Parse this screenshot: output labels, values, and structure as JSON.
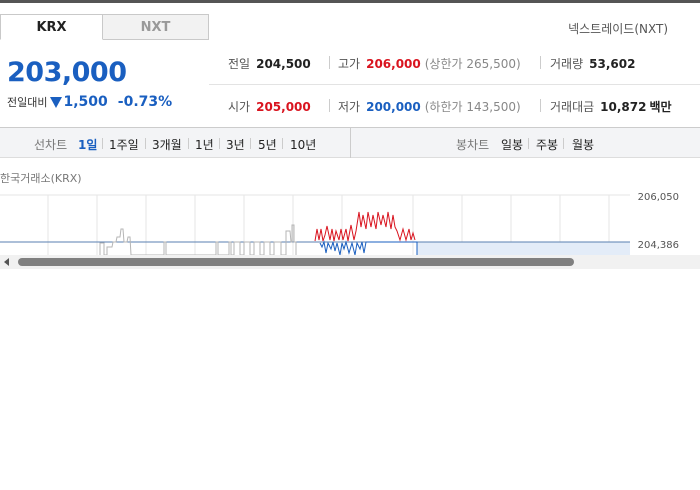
{
  "tabs": [
    "KRX",
    "NXT"
  ],
  "nxt_link": "넥스트레이드(NXT)",
  "price": "203,000",
  "change": {
    "label": "전일대비",
    "value": "1,500",
    "percent": "-0.73%"
  },
  "stats": {
    "prev_close": {
      "label": "전일",
      "value": "204,500"
    },
    "high": {
      "label": "고가",
      "value": "206,000",
      "sub": "(상한가 265,500)"
    },
    "volume": {
      "label": "거래량",
      "value": "53,602"
    },
    "open": {
      "label": "시가",
      "value": "205,000"
    },
    "low": {
      "label": "저가",
      "value": "200,000",
      "sub": "(하한가 143,500)"
    },
    "turnover": {
      "label": "거래대금",
      "value": "10,872",
      "unit": "백만"
    }
  },
  "line_chart": {
    "label": "선차트",
    "periods": [
      "1일",
      "1주일",
      "3개월",
      "1년",
      "3년",
      "5년",
      "10년"
    ],
    "selected": "1일"
  },
  "candle_chart": {
    "label": "봉차트",
    "periods": [
      "일봉",
      "주봉",
      "월봉"
    ]
  },
  "exchange_label": "한국거래소(KRX)",
  "chart_data": {
    "type": "line",
    "y_ticks": [
      "206,050",
      "204,386"
    ],
    "reference_price": 204386,
    "grid": true
  },
  "colors": {
    "up": "#d9141f",
    "down": "#1a5fc0",
    "accent": "#1a5fc0"
  }
}
